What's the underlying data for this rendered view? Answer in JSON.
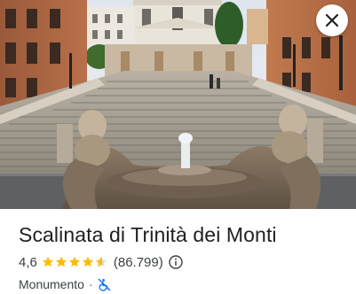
{
  "place": {
    "name": "Scalinata di Trinità dei Monti",
    "rating": "4,6",
    "rating_value": 4.6,
    "review_count": "(86.799)",
    "category": "Monumento",
    "separator": "·"
  },
  "icons": {
    "close": "close-icon",
    "info": "info-icon",
    "accessibility": "wheelchair-crossed-icon",
    "star": "star-icon"
  },
  "colors": {
    "star": "#fbbc04",
    "star_empty": "#dadce0",
    "accessibility": "#1a73e8",
    "text": "#202124"
  }
}
